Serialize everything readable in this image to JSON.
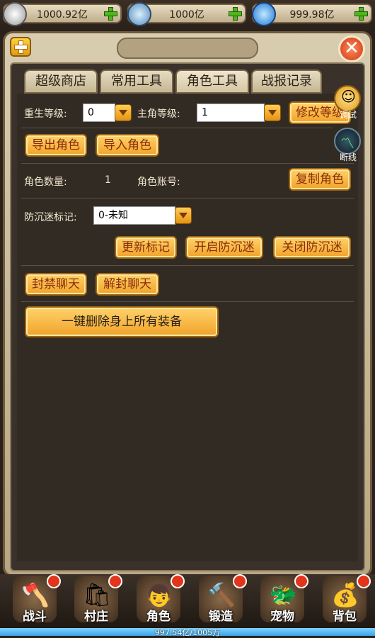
{
  "resources": [
    {
      "value": "1000.92亿",
      "icon": "silver-coin-icon"
    },
    {
      "value": "1000亿",
      "icon": "locked-gem-icon"
    },
    {
      "value": "999.98亿",
      "icon": "blue-crystal-icon"
    }
  ],
  "tabs": [
    "超级商店",
    "常用工具",
    "角色工具",
    "战报记录"
  ],
  "rebirth": {
    "label": "重生等级:",
    "value": "0"
  },
  "level": {
    "label": "主角等级:",
    "value": "1",
    "button": "修改等级"
  },
  "buttons_row2": {
    "export": "导出角色",
    "import": "导入角色"
  },
  "role_info": {
    "count_label": "角色数量:",
    "count_value": "1",
    "account_label": "角色账号:",
    "copy_button": "复制角色"
  },
  "anti_addiction": {
    "label": "防沉迷标记:",
    "value": "0-未知",
    "update_button": "更新标记",
    "enable_button": "开启防沉迷",
    "disable_button": "关闭防沉迷"
  },
  "chat": {
    "ban_button": "封禁聊天",
    "unban_button": "解封聊天"
  },
  "delete_equipment_button": "一键删除身上所有装备",
  "side": {
    "debug_label": "调试",
    "disconnect_label": "断线"
  },
  "nav": [
    "战斗",
    "村庄",
    "角色",
    "锻造",
    "宠物",
    "背包"
  ],
  "exp_text": "997.54亿/1005万"
}
